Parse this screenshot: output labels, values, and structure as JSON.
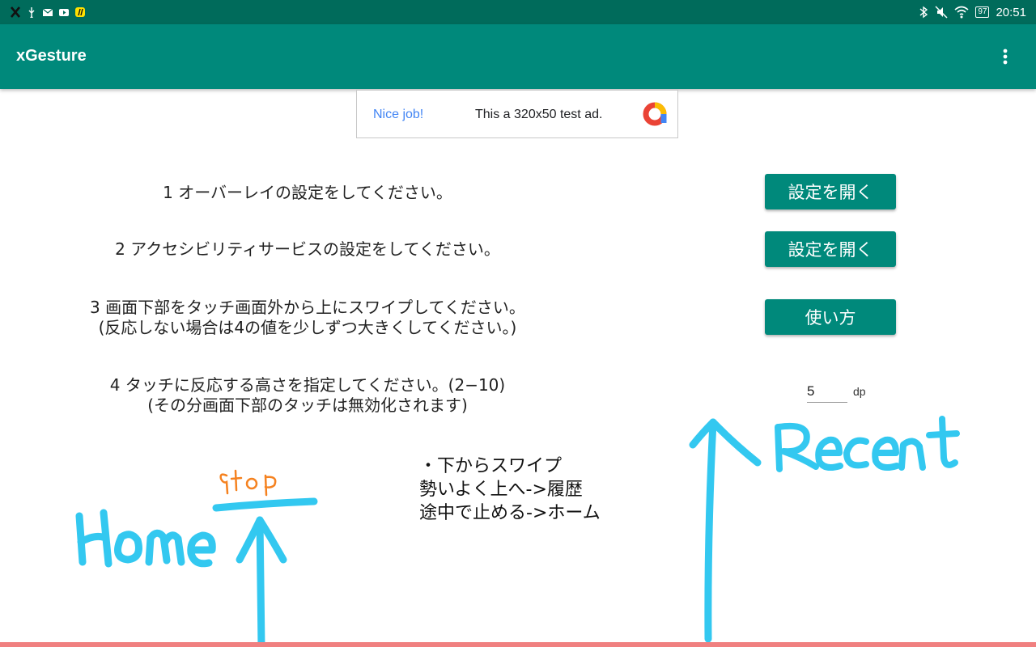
{
  "status_bar": {
    "left_icons": [
      "x-app-icon",
      "usb-icon",
      "mail-icon",
      "youtube-icon",
      "app-badge-icon"
    ],
    "right_icons": [
      "bluetooth-icon",
      "mute-icon",
      "wifi-icon",
      "battery-icon"
    ],
    "battery": "97",
    "time": "20:51"
  },
  "app_bar": {
    "title": "xGesture",
    "menu_icon": "more-vert-icon"
  },
  "ad": {
    "headline": "Nice job!",
    "text": "This a 320x50 test ad."
  },
  "steps": [
    {
      "text": "1 オーバーレイの設定をしてください。",
      "button": "設定を開く"
    },
    {
      "text": "2 アクセシビリティサービスの設定をしてください。",
      "button": "設定を開く"
    },
    {
      "line1": "3 画面下部をタッチ画面外から上にスワイプしてください。",
      "line2": "(反応しない場合は4の値を少しずつ大きくしてください。)",
      "button": "使い方"
    },
    {
      "line1": "4 タッチに反応する高さを指定してください。(2−10)",
      "line2": "(その分画面下部のタッチは無効化されます)",
      "value": "5",
      "unit": "dp"
    }
  ],
  "instructions": [
    "・下からスワイプ",
    "勢いよく上へ->履歴",
    "途中で止める->ホーム"
  ],
  "colors": {
    "status_bar": "#006b5b",
    "app_bar": "#00897b",
    "button": "#00897b",
    "gesture_ink": "#33c8f0",
    "stop_ink": "#f58220",
    "bottom_strip": "#f08080"
  }
}
